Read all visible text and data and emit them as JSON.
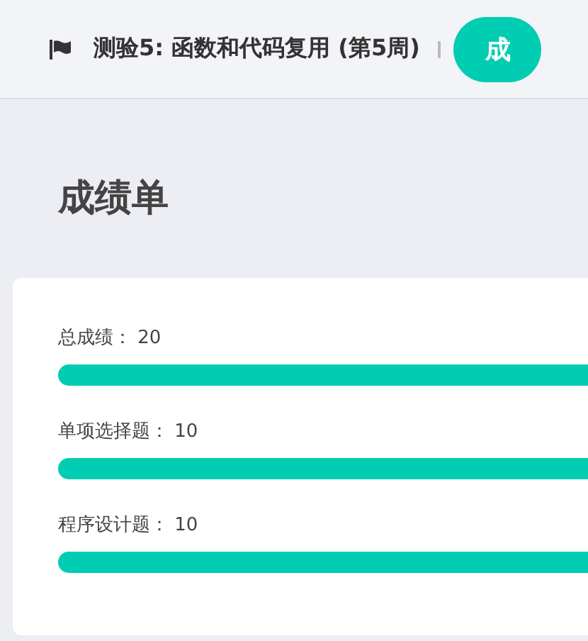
{
  "header": {
    "title": "测验5: 函数和代码复用 (第5周)",
    "button": "成"
  },
  "page_title": "成绩单",
  "scores": [
    {
      "label": "总成绩： 20",
      "level": 1
    },
    {
      "label": "单项选择题： 10",
      "level": 1
    },
    {
      "label": "程序设计题： 10",
      "level": 1
    }
  ]
}
